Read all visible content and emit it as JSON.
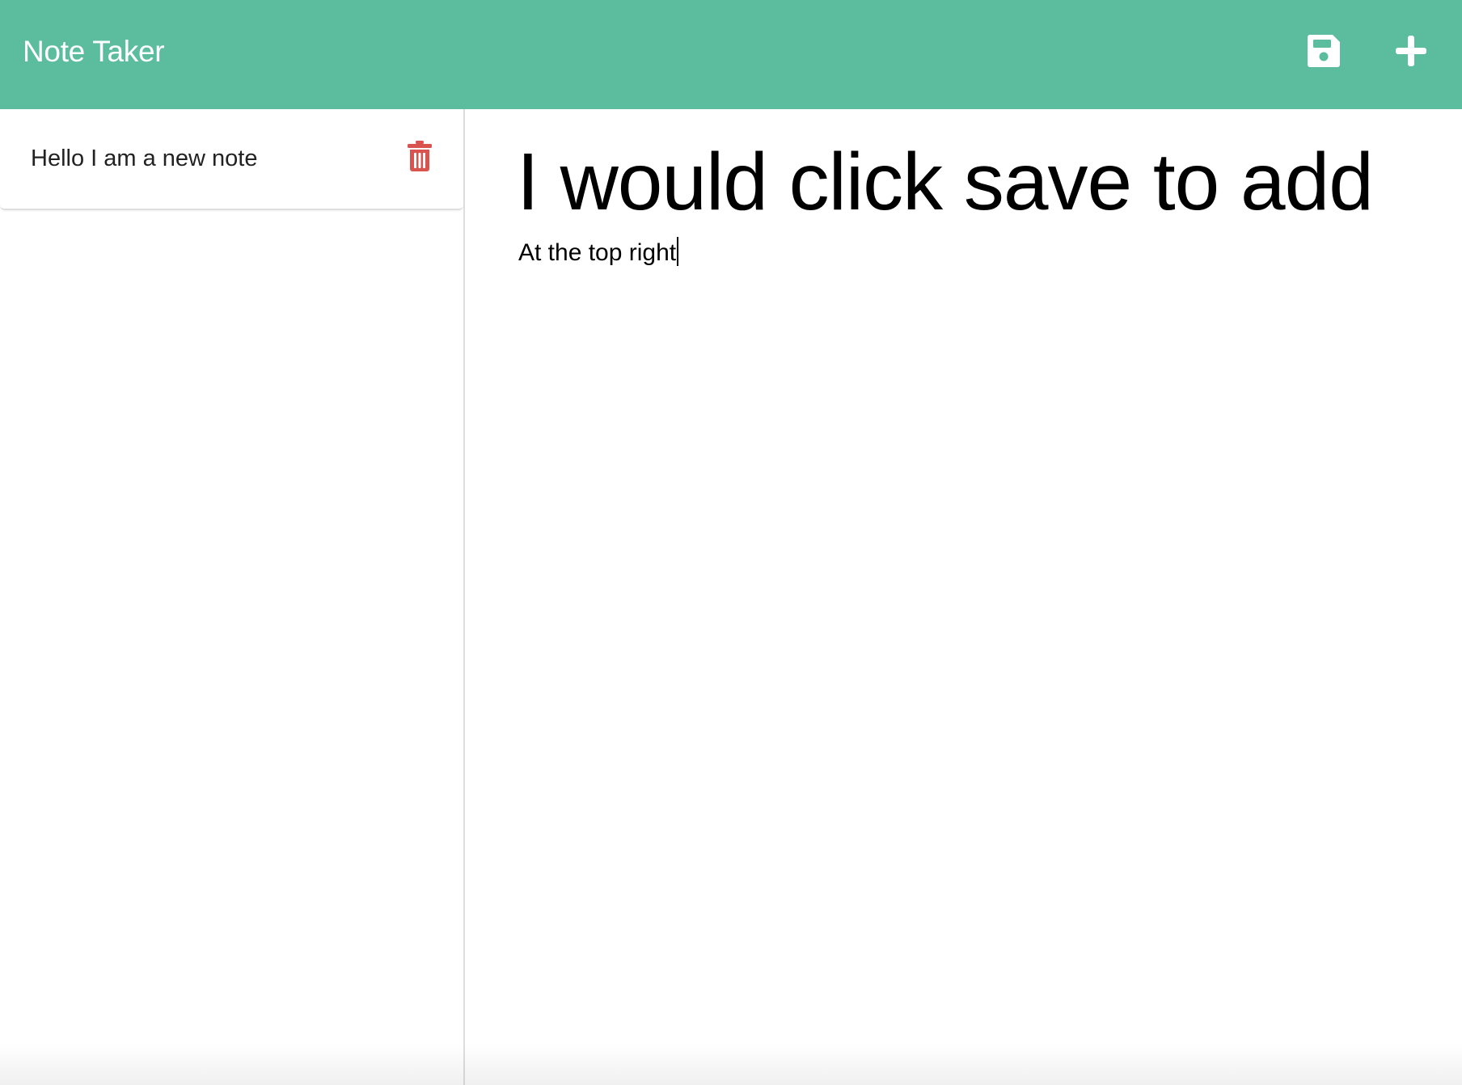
{
  "app": {
    "title": "Note Taker",
    "accent_color": "#5bbc9e",
    "delete_color": "#d9534f"
  },
  "toolbar": {
    "save_icon": "floppy-disk-icon",
    "add_icon": "plus-icon"
  },
  "sidebar": {
    "notes": [
      {
        "title": "Hello I am a new note",
        "delete_icon": "trash-icon"
      }
    ]
  },
  "editor": {
    "title_value": "I would click save to add",
    "body_value": "At the top right"
  }
}
